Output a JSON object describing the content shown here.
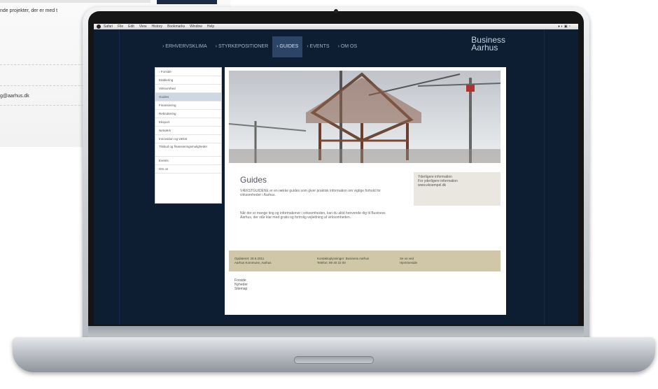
{
  "background_page": {
    "text_line": "nde projekter, der er med t",
    "email_text": "g@aarhus.dk"
  },
  "mac_menubar": {
    "items": [
      "Safari",
      "File",
      "Edit",
      "View",
      "History",
      "Bookmarks",
      "Window",
      "Help"
    ]
  },
  "site": {
    "nav": [
      "› ERHVERVSKLIMA",
      "› STYRKEPOSITIONER",
      "› GUIDES",
      "› EVENTS",
      "› OM OS"
    ],
    "active_nav": "› GUIDES",
    "logo_line1": "Business",
    "logo_line2": "Aarhus",
    "sidebar": [
      "› Forside",
      "Etablering",
      "Virksomhed",
      "Guides",
      "Finansiering",
      "Rekruttering",
      "Eksport",
      "Netværk",
      "Innovation og vækst",
      "Tilskud og finansieringsmuligheder",
      "Events",
      "Om os"
    ],
    "active_sidebar": "Guides",
    "page_title": "Guides",
    "intro": "VÆKSTGUIDENE er en række guides som giver praktisk information om vigtige forhold for virksomheder i Aarhus.",
    "intro2": "Når der er mange ting og informationer i virksomheden, kan du altid henvende dig til Business Aarhus, der står klar med gratis og fortrolig vejledning af virksomheden.",
    "infobox_title": "Yderligere information",
    "infobox_line1": "For yderligere information",
    "infobox_line2": "www.eksempel.dk",
    "footer_col1_a": "Opdateret: 28.6.2011",
    "footer_col1_b": "Aarhus Kommune, Aarhus",
    "footer_col2_a": "Kontaktoplysninger: Business Aarhus",
    "footer_col2_b": "Telefon: 89 40 22 00",
    "footer_col3_a": "Se os ved",
    "footer_col3_b": "Hjemmeside",
    "footer_links": [
      "Forside",
      "Nyheder",
      "Sitemap"
    ]
  }
}
